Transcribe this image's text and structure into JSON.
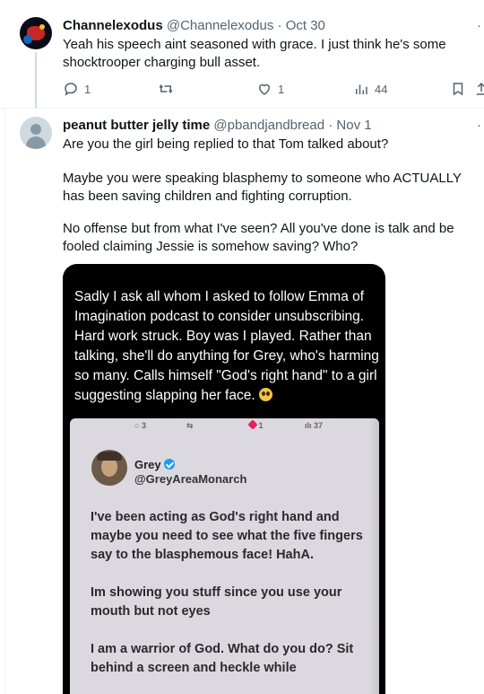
{
  "tweet1": {
    "name": "Channelexodus",
    "handle": "@Channelexodus",
    "separator": "·",
    "date": "Oct 30",
    "text": "Yeah his speech aint seasoned with grace. I just think he's some shocktrooper charging bull asset.",
    "replies": "1",
    "likes": "1",
    "views": "44",
    "more": "·"
  },
  "tweet2": {
    "name": "peanut butter jelly time",
    "handle": "@pbandjandbread",
    "separator": "·",
    "date": "Nov 1",
    "more": "·",
    "paragraphs": [
      "Are you the girl being replied to that Tom talked about?",
      "Maybe you were speaking blasphemy to someone who ACTUALLY has been saving children and fighting corruption.",
      "No offense but from what I've seen? All you've done is talk and be fooled claiming Jessie is somehow saving? Who?"
    ],
    "media": {
      "caption": "Sadly I ask all whom I asked to follow Emma of Imagination podcast to consider unsubscribing. Hard work struck. Boy was I played. Rather than talking, she'll do anything for Grey, who's harming so many. Calls himself \"God's right hand\" to a girl suggesting slapping her face.",
      "photo": {
        "replies": "3",
        "likes": "1",
        "views": "37",
        "name": "Grey",
        "handle": "@GreyAreaMonarch",
        "paragraphs": [
          "I've been acting as God's right hand and maybe you need to see what the five fingers say to the blasphemous face! HahA.",
          "Im showing you stuff since you use your mouth but not eyes",
          "I am a warrior of God. What do you do? Sit behind a screen and heckle while"
        ]
      }
    }
  },
  "colors": {
    "text": "#0f1419",
    "secondary": "#536471",
    "divider": "#eff3f4",
    "thread_line": "#cfd9de",
    "verified": "#1d9bf0",
    "like_red": "#e0245e"
  }
}
